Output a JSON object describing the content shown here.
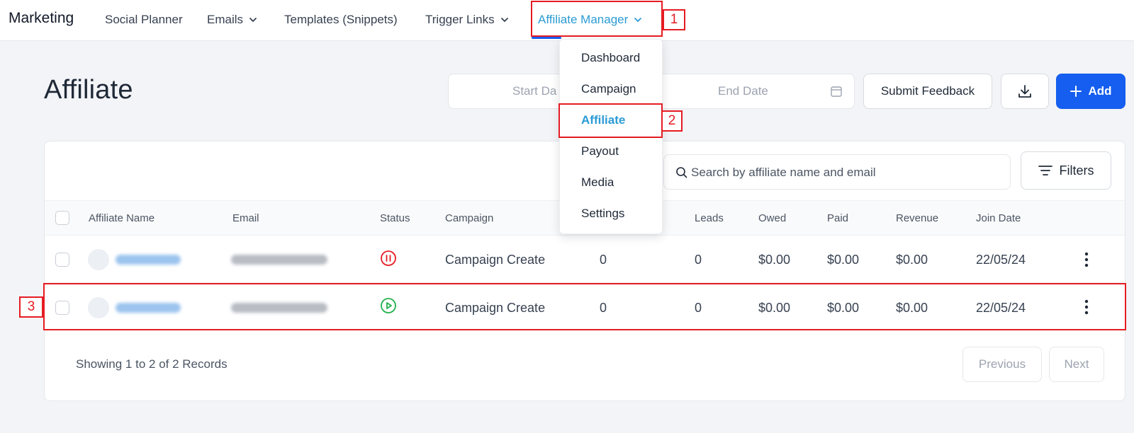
{
  "app": {
    "brand": "Marketing"
  },
  "nav": {
    "items": [
      {
        "label": "Social Planner"
      },
      {
        "label": "Emails"
      },
      {
        "label": "Templates (Snippets)"
      },
      {
        "label": "Trigger Links"
      },
      {
        "label": "Affiliate Manager",
        "active": true
      }
    ]
  },
  "dropdown": {
    "items": [
      {
        "label": "Dashboard"
      },
      {
        "label": "Campaign"
      },
      {
        "label": "Affiliate",
        "active": true
      },
      {
        "label": "Payout"
      },
      {
        "label": "Media"
      },
      {
        "label": "Settings"
      }
    ]
  },
  "header": {
    "title": "Affiliate",
    "start_date_placeholder": "Start Da",
    "end_date_placeholder": "End Date",
    "feedback_label": "Submit Feedback",
    "add_label": "Add"
  },
  "search": {
    "placeholder": "Search by affiliate name and email",
    "filters_label": "Filters"
  },
  "table": {
    "columns": [
      "Affiliate Name",
      "Email",
      "Status",
      "Campaign",
      "Leads",
      "Owed",
      "Paid",
      "Revenue",
      "Join Date"
    ],
    "rows": [
      {
        "status": "paused",
        "campaign": "Campaign Create",
        "col5": "0",
        "leads": "0",
        "owed": "$0.00",
        "paid": "$0.00",
        "revenue": "$0.00",
        "join_date": "22/05/24"
      },
      {
        "status": "active",
        "campaign": "Campaign Create",
        "col5": "0",
        "leads": "0",
        "owed": "$0.00",
        "paid": "$0.00",
        "revenue": "$0.00",
        "join_date": "22/05/24"
      }
    ]
  },
  "footer": {
    "records_text": "Showing 1 to 2 of 2 Records",
    "previous_label": "Previous",
    "next_label": "Next"
  },
  "annotations": {
    "labels": [
      "1",
      "2",
      "3"
    ]
  },
  "colors": {
    "accent": "#155eef",
    "active_link": "#2b9bd4",
    "annotation": "#e51c23",
    "status_paused": "#e51c23",
    "status_active": "#22b14c"
  },
  "icons": {
    "chevron": "chevron-down-icon",
    "calendar": "calendar-icon",
    "download": "download-icon",
    "add": "plus-icon",
    "search": "search-icon",
    "filters": "filter-icon",
    "row_menu": "kebab-menu-icon",
    "status_paused": "pause-circle-icon",
    "status_active": "play-circle-icon"
  }
}
